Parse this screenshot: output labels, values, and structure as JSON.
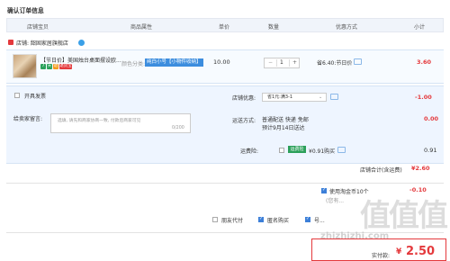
{
  "page": {
    "title": "确认订单信息"
  },
  "header": {
    "cols": [
      "店铺宝贝",
      "商品属性",
      "单价",
      "数量",
      "优惠方式",
      "小计"
    ]
  },
  "shop": {
    "label": "店铺: 韶固家居旗舰店"
  },
  "item": {
    "name": "【节日价】美国烛台桌面摆设欧...",
    "badges": [
      "7",
      "天",
      "退",
      "退货宝"
    ],
    "attr_label": "颜色分类:",
    "attr_value": "纯白小号【小物件收纳】",
    "unit_price": "10.00",
    "quantity": "1",
    "minus": "−",
    "plus": "+",
    "discount": "省6.40:节日价",
    "subtotal": "3.60"
  },
  "options": {
    "invoice_label": "开具发票",
    "message_label": "给卖家留言:",
    "message_placeholder": "选填, 请先和商家协商一致, 付款后商家可见",
    "message_count": "0/200",
    "shop_discount_label": "店铺优惠:",
    "shop_discount_value": "省1元:满3-1",
    "shop_discount_amount": "-1.00",
    "shipping_label": "运送方式:",
    "shipping_value": "普通配送 快递 免邮",
    "shipping_eta": "预计9月14日送达",
    "shipping_amount": "0.00",
    "freight_insurance_label": "运费险:",
    "freight_insurance_tag": "运费险",
    "freight_insurance_value": "¥0.91购买",
    "freight_insurance_amount": "0.91",
    "shop_total_label": "店铺合计(含运费)",
    "shop_total_value": "¥2.60"
  },
  "coins": {
    "label": "使用淘金币10个",
    "note": "(您有...",
    "amount": "-0.10"
  },
  "footer": {
    "pay_for_other": "朋友代付",
    "anonymous": "匿名购买",
    "extra": "号...",
    "pay_label": "实付款:",
    "currency": "¥",
    "pay_amount": "2.50"
  },
  "watermark": {
    "big": "值值值",
    "small": "zhizhizhi.com"
  },
  "colors": {
    "accent": "#e4393c",
    "brand_blue": "#3c7fd8"
  }
}
